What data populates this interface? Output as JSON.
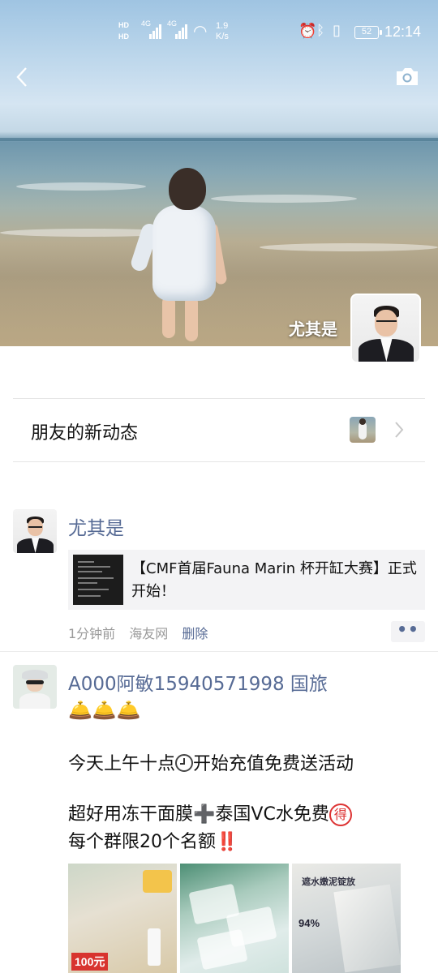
{
  "status_bar": {
    "hd1": "HD",
    "hd2": "HD",
    "net1": "4G",
    "net2": "4G",
    "speed_value": "1.9",
    "speed_unit": "K/s",
    "battery": "52",
    "time": "12:14"
  },
  "cover": {
    "user_name": "尤其是"
  },
  "friend_updates": {
    "label": "朋友的新动态"
  },
  "posts": [
    {
      "author": "尤其是",
      "share_title": "【CMF首届Fauna Marin 杯开缸大赛】正式开始！",
      "time": "1分钟前",
      "source": "海友网",
      "delete_label": "删除",
      "more_label": "••"
    },
    {
      "author": "A000阿敏15940571998 国旅",
      "emoji_line": "🛎️🛎️🛎️",
      "line1_a": "今天上午十点",
      "line1_b": "开始充值免费送活动",
      "line2_a": "超好用冻干面膜",
      "line2_plus": "➕",
      "line2_b": "泰国VC水免费",
      "line2_badge": "得",
      "line3_a": "每个群限20个名额",
      "line3_bang": "‼️",
      "images": [
        {
          "price": "100元",
          "icon": "mask-product-photo"
        },
        {
          "icon": "mask-packs-photo"
        },
        {
          "pct": "94%",
          "head": "遮水嫩泥锭放",
          "icon": "vc-box-photo"
        }
      ]
    }
  ],
  "icons": {
    "back": "chevron-left-icon",
    "camera": "camera-icon",
    "chevron": "chevron-right-icon"
  }
}
